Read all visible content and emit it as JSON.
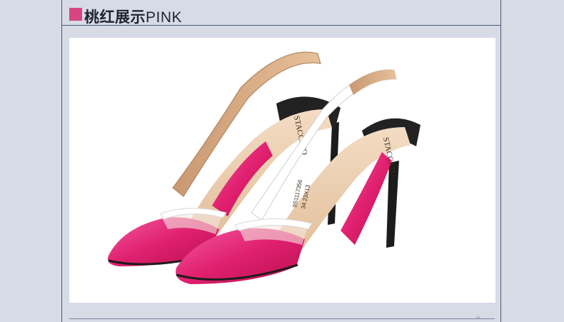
{
  "section": {
    "title_cn": "桃红展示",
    "title_en": "PINK",
    "accent_color": "#d9467f"
  },
  "product_image": {
    "subject": "pink-slingback-pumps-pair",
    "insole_brand_text": "STACCATO",
    "insole_code_text": "9S1117356",
    "insole_size_text": "34 23X13"
  }
}
